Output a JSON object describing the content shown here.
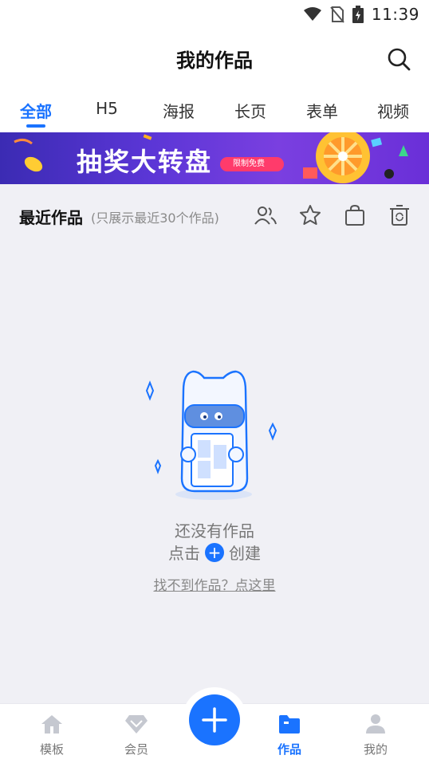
{
  "status": {
    "time": "11:39",
    "icons": [
      "wifi-icon",
      "no-sim-icon",
      "battery-charging-icon"
    ]
  },
  "header": {
    "title": "我的作品",
    "search_icon": "search-icon"
  },
  "tabs": [
    {
      "label": "全部",
      "active": true
    },
    {
      "label": "H5",
      "active": false
    },
    {
      "label": "海报",
      "active": false
    },
    {
      "label": "长页",
      "active": false
    },
    {
      "label": "表单",
      "active": false
    },
    {
      "label": "视频",
      "active": false
    }
  ],
  "banner": {
    "title": "抽奖大转盘",
    "tag": "限制免费"
  },
  "section": {
    "title": "最近作品",
    "note": "(只展示最近30个作品)",
    "icons": [
      "collaborators-icon",
      "star-icon",
      "bag-icon",
      "recycle-bin-icon"
    ]
  },
  "empty_state": {
    "line1": "还没有作品",
    "line2_prefix": "点击",
    "line2_suffix": "创建",
    "link": "找不到作品？点这里"
  },
  "bottom_nav": [
    {
      "label": "模板",
      "icon": "house-icon",
      "active": false
    },
    {
      "label": "会员",
      "icon": "diamond-icon",
      "active": false
    },
    {
      "label": "作品",
      "icon": "folder-icon",
      "active": true
    },
    {
      "label": "我的",
      "icon": "person-icon",
      "active": false
    }
  ],
  "colors": {
    "accent": "#1a73ff",
    "background": "#f0f0f5"
  }
}
